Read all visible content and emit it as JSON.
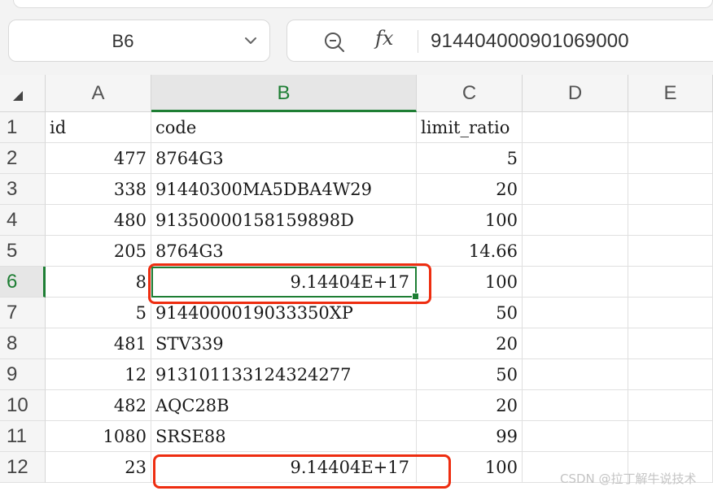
{
  "name_box": {
    "ref": "B6"
  },
  "formula_bar": {
    "fx_label": "fx",
    "value": "914404000901069000"
  },
  "columns": [
    "A",
    "B",
    "C",
    "D",
    "E"
  ],
  "active_column": "B",
  "rows": [
    {
      "num": "1",
      "a": "id",
      "b": "code",
      "c": "limit_ratio"
    },
    {
      "num": "2",
      "a": "477",
      "b": "8764G3",
      "c": "5"
    },
    {
      "num": "3",
      "a": "338",
      "b": "91440300MA5DBA4W29",
      "c": "20"
    },
    {
      "num": "4",
      "a": "480",
      "b": "91350000158159898D",
      "c": "100"
    },
    {
      "num": "5",
      "a": "205",
      "b": "8764G3",
      "c": "14.66"
    },
    {
      "num": "6",
      "a": "8",
      "b": "9.14404E+17",
      "c": "100"
    },
    {
      "num": "7",
      "a": "5",
      "b": "9144000019033350XP",
      "c": "50"
    },
    {
      "num": "8",
      "a": "481",
      "b": "STV339",
      "c": "20"
    },
    {
      "num": "9",
      "a": "12",
      "b": "913101133124324277",
      "c": "50"
    },
    {
      "num": "10",
      "a": "482",
      "b": "AQC28B",
      "c": "20"
    },
    {
      "num": "11",
      "a": "1080",
      "b": "SRSE88",
      "c": "99"
    },
    {
      "num": "12",
      "a": "23",
      "b": "9.14404E+17",
      "c": "100"
    }
  ],
  "watermark": "CSDN @拉丁解牛说技术",
  "colors": {
    "selection": "#1e7e34",
    "highlight": "#ee2d10"
  }
}
